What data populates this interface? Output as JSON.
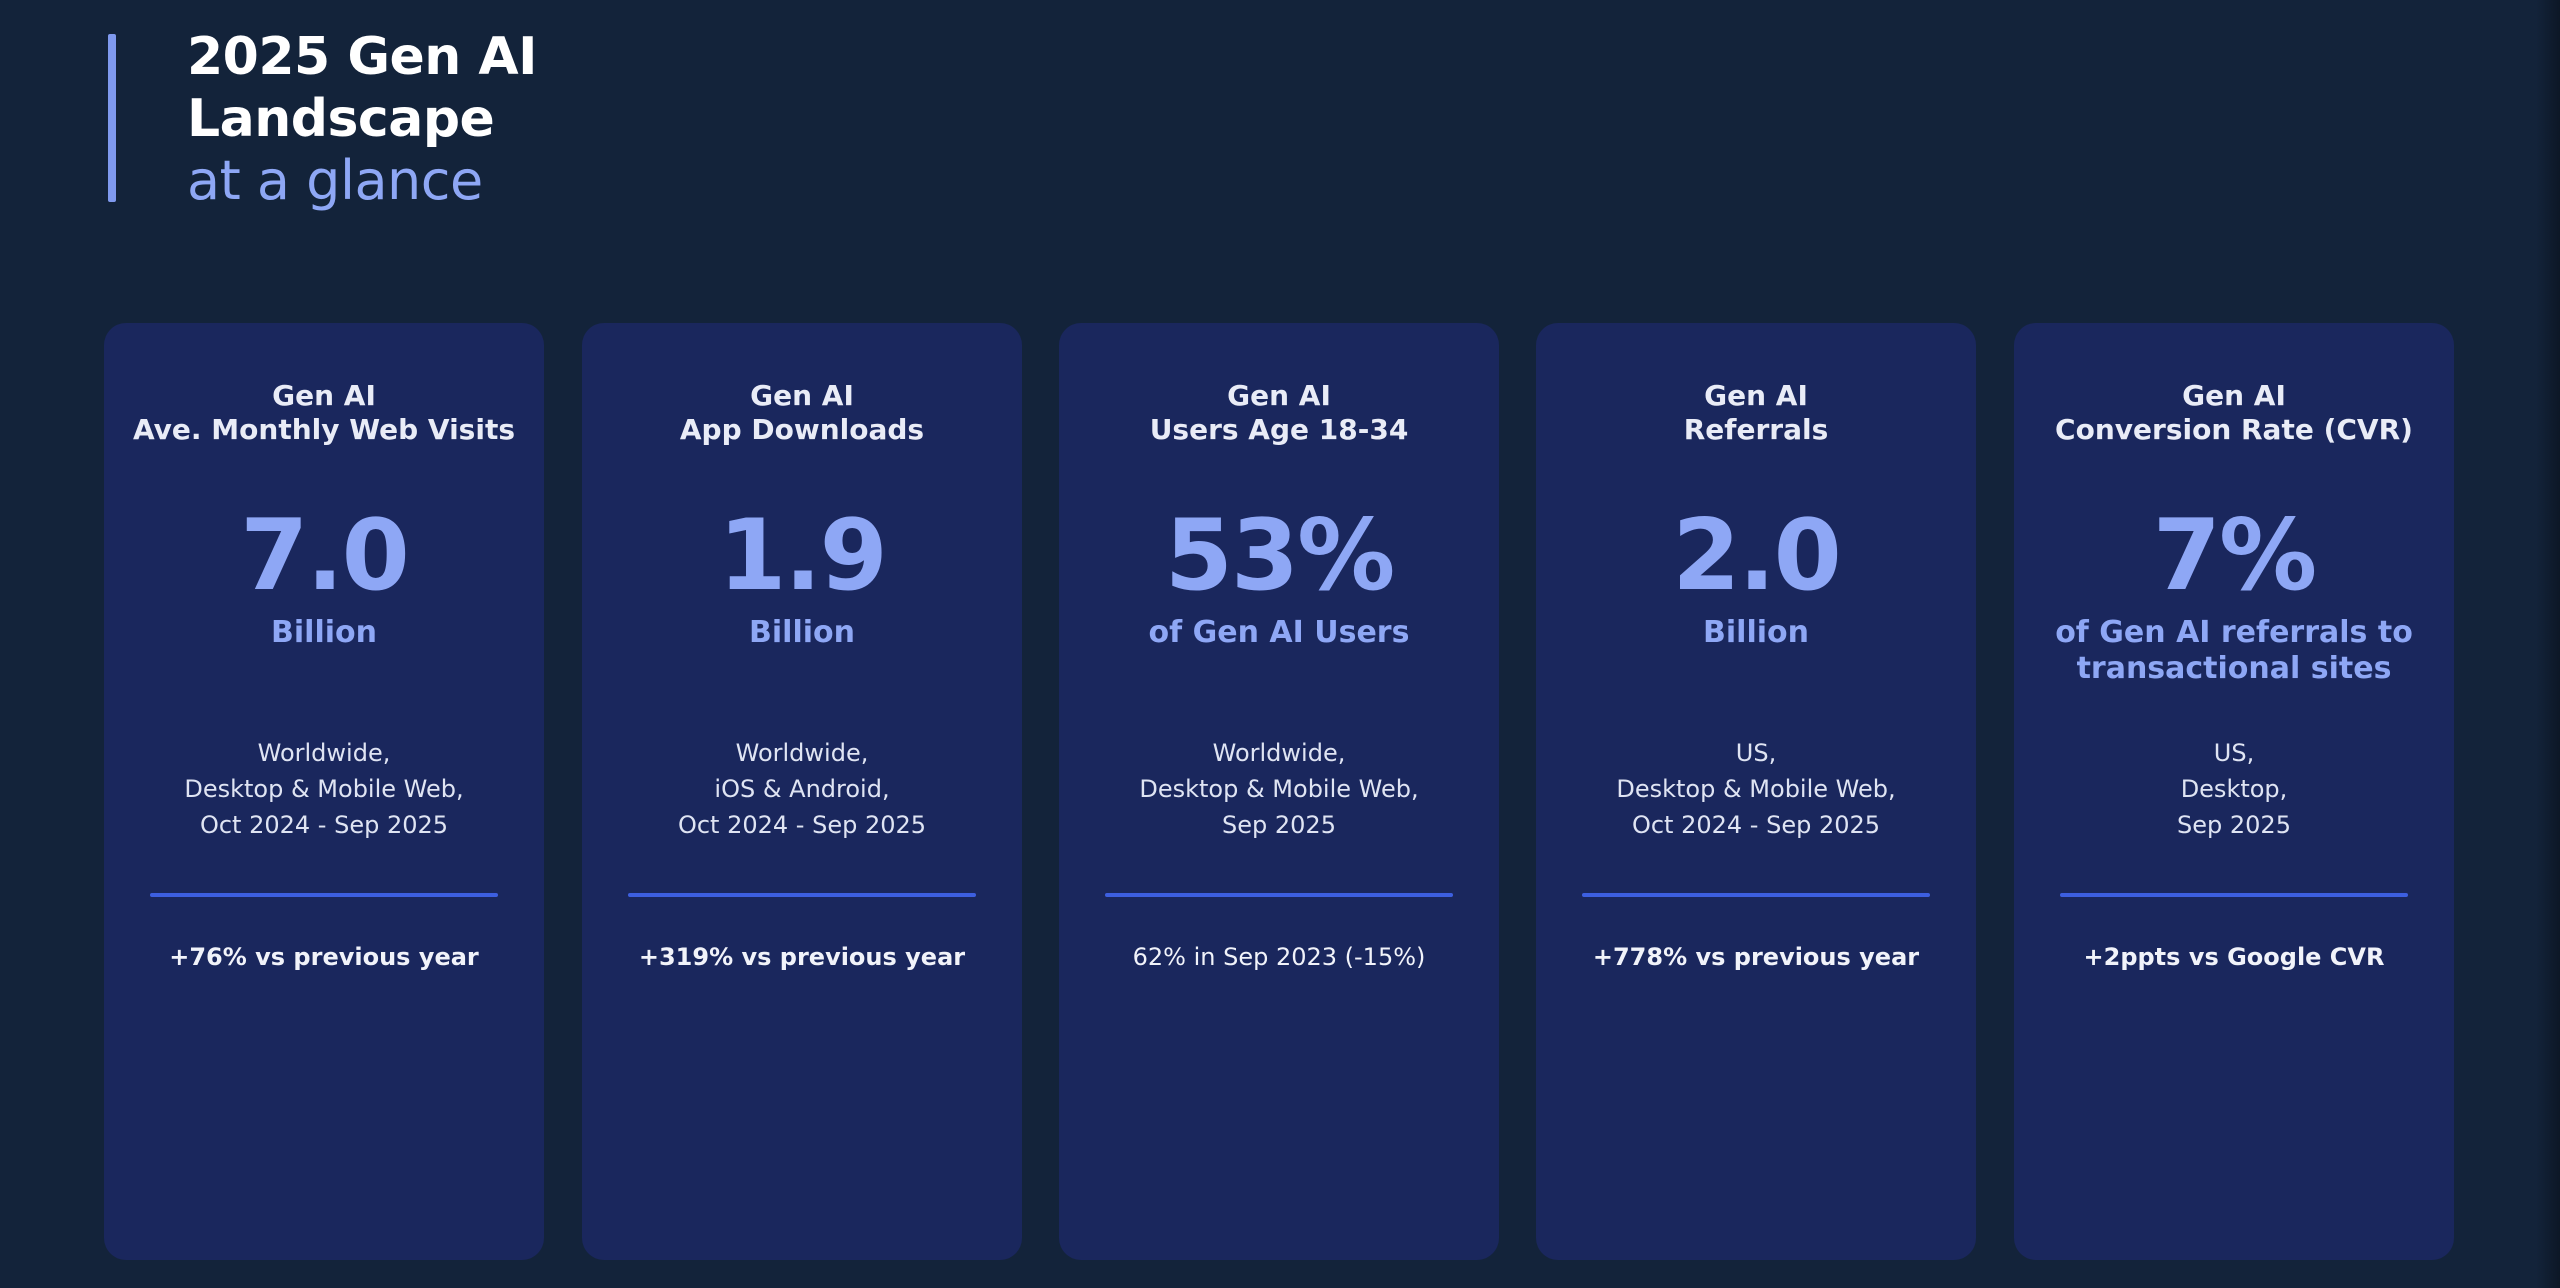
{
  "header": {
    "title_line1": "2025 Gen AI",
    "title_line2": "Landscape",
    "subtitle": "at a glance"
  },
  "cards": [
    {
      "title_line1": "Gen AI",
      "title_line2": "Ave. Monthly Web Visits",
      "value": "7.0",
      "unit_line1": "Billion",
      "unit_line2": "",
      "scope_line1": "Worldwide,",
      "scope_line2": "Desktop & Mobile Web,",
      "scope_line3": "Oct 2024 - Sep 2025",
      "change": "+76% vs previous year"
    },
    {
      "title_line1": "Gen AI",
      "title_line2": "App Downloads",
      "value": "1.9",
      "unit_line1": "Billion",
      "unit_line2": "",
      "scope_line1": "Worldwide,",
      "scope_line2": "iOS & Android,",
      "scope_line3": "Oct 2024 - Sep 2025",
      "change": "+319% vs previous year"
    },
    {
      "title_line1": "Gen AI",
      "title_line2": "Users Age 18-34",
      "value": "53%",
      "unit_line1": "of Gen AI Users",
      "unit_line2": "",
      "scope_line1": "Worldwide,",
      "scope_line2": "Desktop & Mobile Web,",
      "scope_line3": "Sep 2025",
      "change": "62% in Sep 2023 (-15%)"
    },
    {
      "title_line1": "Gen AI",
      "title_line2": "Referrals",
      "value": "2.0",
      "unit_line1": "Billion",
      "unit_line2": "",
      "scope_line1": "US,",
      "scope_line2": "Desktop & Mobile Web,",
      "scope_line3": "Oct 2024 - Sep 2025",
      "change": "+778% vs previous year"
    },
    {
      "title_line1": "Gen AI",
      "title_line2": "Conversion Rate (CVR)",
      "value": "7%",
      "unit_line1": "of Gen AI referrals to",
      "unit_line2": "transactional sites",
      "scope_line1": "US,",
      "scope_line2": "Desktop,",
      "scope_line3": "Sep 2025",
      "change": "+2ppts vs Google CVR"
    }
  ]
}
